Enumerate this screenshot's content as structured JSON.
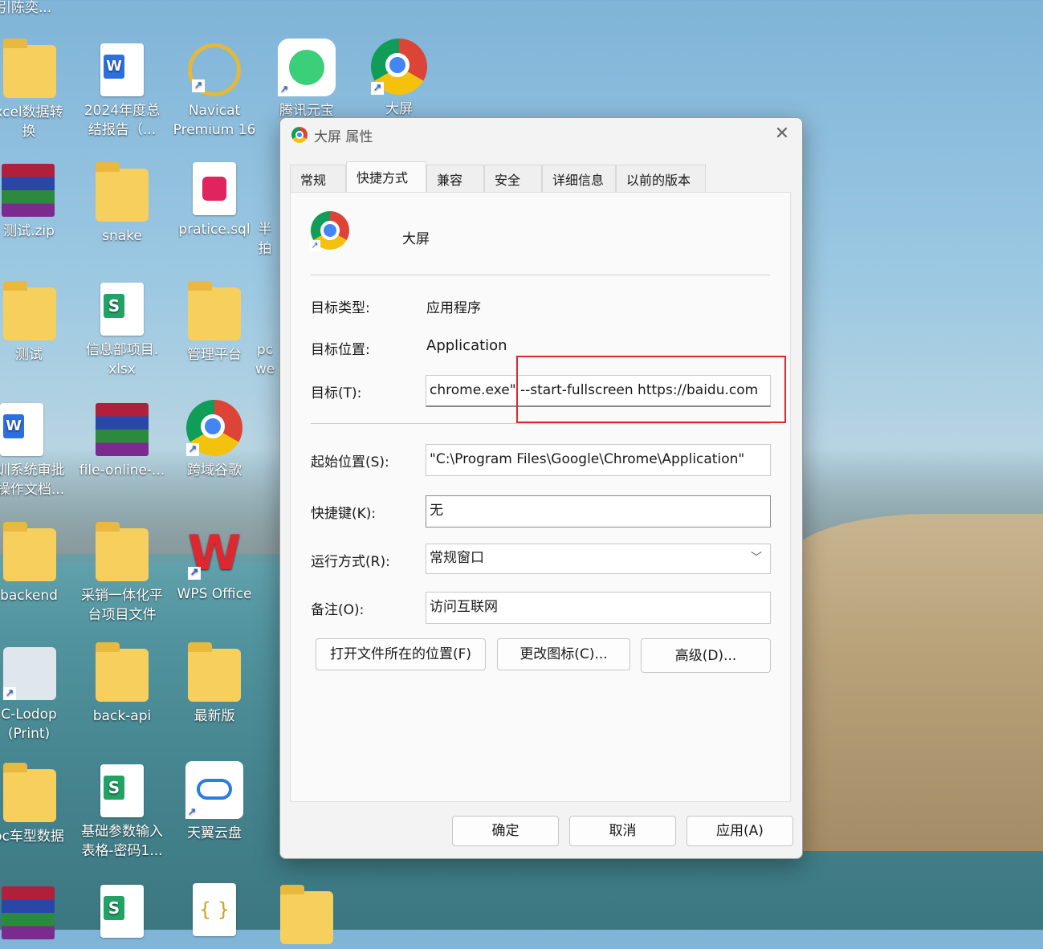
{
  "desktop": {
    "top_partial_label": "刂引陈奕...",
    "icons": [
      {
        "label": "xcel数据转\n换"
      },
      {
        "label": "2024年度总\n结报告（..."
      },
      {
        "label": "Navicat\nPremium 16"
      },
      {
        "label": "腾讯元宝"
      },
      {
        "label": "大屏"
      },
      {
        "label": "测试.zip"
      },
      {
        "label": "snake"
      },
      {
        "label": "pratice.sql"
      },
      {
        "label": "半\n拍"
      },
      {
        "label": "测试"
      },
      {
        "label": "信息部项目.\nxlsx"
      },
      {
        "label": "管理平台"
      },
      {
        "label": "pc\nwe"
      },
      {
        "label": "训系统审批\n操作文档..."
      },
      {
        "label": "file-online-..."
      },
      {
        "label": "跨域谷歌"
      },
      {
        "label": "backend"
      },
      {
        "label": "采销一体化平\n台项目文件"
      },
      {
        "label": "WPS Office"
      },
      {
        "label": "C-Lodop\n(Print)"
      },
      {
        "label": "back-api"
      },
      {
        "label": "最新版"
      },
      {
        "label": "oc车型数据"
      },
      {
        "label": "基础参数输入\n表格-密码1..."
      },
      {
        "label": "天翼云盘"
      }
    ]
  },
  "dialog": {
    "title": "大屏 属性",
    "close": "✕",
    "tabs": [
      {
        "label": "常规"
      },
      {
        "label": "快捷方式"
      },
      {
        "label": "兼容性"
      },
      {
        "label": "安全"
      },
      {
        "label": "详细信息"
      },
      {
        "label": "以前的版本"
      }
    ],
    "shortcut_name": "大屏",
    "target_type_label": "目标类型:",
    "target_type_value": "应用程序",
    "target_location_label": "目标位置:",
    "target_location_value": "Application",
    "target_label": "目标(T):",
    "target_value": "chrome.exe\" --start-fullscreen https://baidu.com",
    "start_in_label": "起始位置(S):",
    "start_in_value": "\"C:\\Program Files\\Google\\Chrome\\Application\"",
    "shortcut_key_label": "快捷键(K):",
    "shortcut_key_value": "无",
    "run_label": "运行方式(R):",
    "run_value": "常规窗口",
    "comment_label": "备注(O):",
    "comment_value": "访问互联网",
    "open_location_button": "打开文件所在的位置(F)",
    "change_icon_button": "更改图标(C)...",
    "advanced_button": "高级(D)...",
    "ok_button": "确定",
    "cancel_button": "取消",
    "apply_button": "应用(A)",
    "colors": {
      "highlight_box": "#e0272d"
    }
  }
}
